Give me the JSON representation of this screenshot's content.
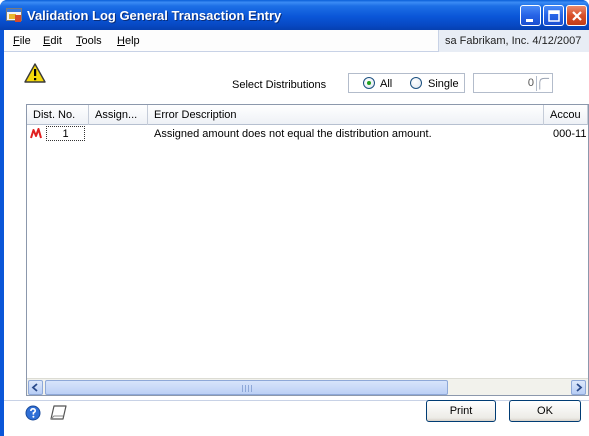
{
  "window": {
    "title": "Validation Log General Transaction Entry",
    "icon": "app-window-icon",
    "controls": [
      "minimize-icon",
      "maximize-icon",
      "close-icon"
    ]
  },
  "menu": {
    "file": {
      "accel": "F",
      "rest": "ile"
    },
    "edit": {
      "accel": "E",
      "rest": "dit"
    },
    "tools": {
      "accel": "T",
      "rest": "ools"
    },
    "help": {
      "accel": "H",
      "rest": "elp"
    }
  },
  "status": {
    "user_company_date": "sa  Fabrikam, Inc.  4/12/2007"
  },
  "filter": {
    "label": "Select Distributions",
    "options": [
      "All",
      "Single"
    ],
    "selected": "All",
    "single_value": "0"
  },
  "grid": {
    "columns": [
      "Dist. No.",
      "Assign...",
      "Error Description",
      "Accou"
    ],
    "rows": [
      {
        "dist_no": "1",
        "assigned": "",
        "error": "Assigned amount does not equal the distribution amount.",
        "account": "000-11"
      }
    ]
  },
  "buttons": {
    "print": "Print",
    "ok": "OK"
  },
  "colors": {
    "titlebar": "#0a56d8",
    "warning": "#f5d90a",
    "error_marker": "#e02020"
  }
}
